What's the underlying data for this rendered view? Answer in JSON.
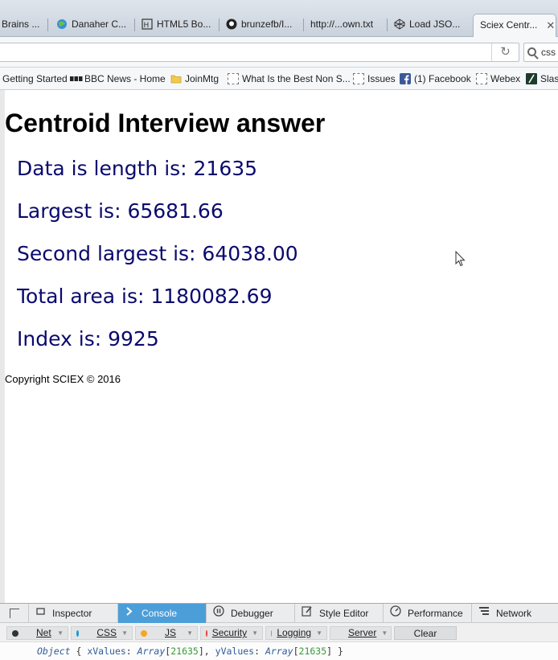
{
  "tabs": [
    {
      "label": "Brains ...",
      "icon": "page-icon",
      "active": false
    },
    {
      "label": "Danaher C...",
      "icon": "globe-icon",
      "active": false
    },
    {
      "label": "HTML5 Bo...",
      "icon": "html5-icon",
      "active": false
    },
    {
      "label": "brunzefb/I...",
      "icon": "github-icon",
      "active": false
    },
    {
      "label": "http://...own.txt",
      "icon": "",
      "active": false
    },
    {
      "label": "Load JSO...",
      "icon": "codepen-icon",
      "active": false
    },
    {
      "label": "Sciex Centr...",
      "icon": "",
      "active": true
    }
  ],
  "navbar": {
    "url": "",
    "search_text": "css"
  },
  "bookmarks": [
    {
      "label": "Getting Started",
      "icon": ""
    },
    {
      "label": "BBC News - Home",
      "icon": "bbc-icon"
    },
    {
      "label": "JoinMtg",
      "icon": "folder-icon"
    },
    {
      "label": "What Is the Best Non S...",
      "icon": "page-icon"
    },
    {
      "label": "Issues",
      "icon": "page-icon"
    },
    {
      "label": "(1) Facebook",
      "icon": "facebook-icon"
    },
    {
      "label": "Webex",
      "icon": "page-icon"
    },
    {
      "label": "Slas",
      "icon": "slash-icon"
    }
  ],
  "page": {
    "title": "Centroid Interview answer",
    "lines": [
      "Data is length is: 21635",
      "Largest is: 65681.66",
      "Second largest is: 64038.00",
      "Total area is: 1180082.69",
      "Index is: 9925"
    ],
    "copyright": "Copyright SCIEX © 2016"
  },
  "devtools": {
    "tabs": [
      {
        "label": "Inspector",
        "icon": "inspector-icon",
        "active": false
      },
      {
        "label": "Console",
        "icon": "console-icon",
        "active": true
      },
      {
        "label": "Debugger",
        "icon": "debugger-icon",
        "active": false
      },
      {
        "label": "Style Editor",
        "icon": "style-editor-icon",
        "active": false
      },
      {
        "label": "Performance",
        "icon": "performance-icon",
        "active": false
      },
      {
        "label": "Network",
        "icon": "network-icon",
        "active": false
      }
    ],
    "filters": [
      {
        "label": "Net",
        "color": "#333333"
      },
      {
        "label": "CSS",
        "color": "#1a9ad6"
      },
      {
        "label": "JS",
        "color": "#f5a623"
      },
      {
        "label": "Security",
        "color": "#e0443e"
      },
      {
        "label": "Logging",
        "color": "#999999"
      },
      {
        "label": "Server",
        "color": "#5aa854"
      }
    ],
    "clear_label": "Clear",
    "console_output": {
      "obj": "Object",
      "open": " { ",
      "k1": "xValues",
      "colon1": ": ",
      "a1": "Array",
      "n1": "21635",
      "mid": ", ",
      "k2": "yValues",
      "colon2": ": ",
      "a2": "Array",
      "n2": "21635",
      "close": " }"
    }
  }
}
